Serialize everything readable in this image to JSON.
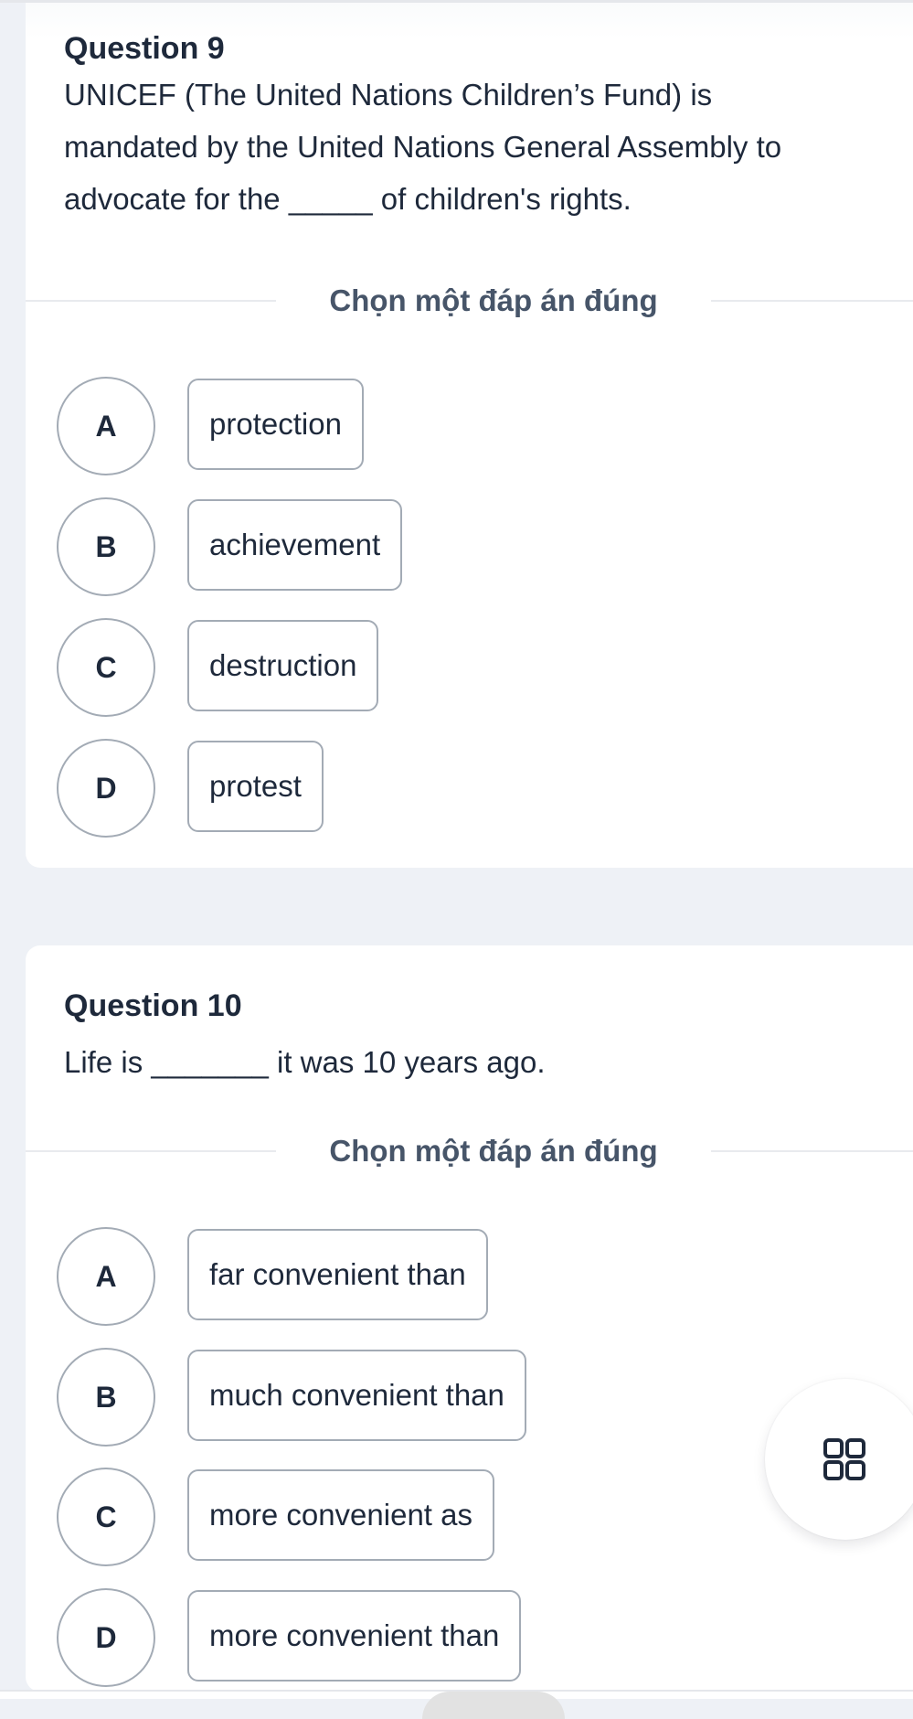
{
  "colors": {
    "page_background": "#eef1f6",
    "card_background": "#ffffff",
    "text_primary": "#1e293b",
    "text_secondary": "#475569",
    "border": "#a3abb5"
  },
  "questions": [
    {
      "title": "Question 9",
      "text_lines": [
        "UNICEF (The United Nations Children’s Fund) is",
        "mandated by the United Nations General Assembly to",
        "advocate for the _____ of children's rights."
      ],
      "instruction": "Chọn một đáp án đúng",
      "options": [
        {
          "letter": "A",
          "text": "protection"
        },
        {
          "letter": "B",
          "text": "achievement"
        },
        {
          "letter": "C",
          "text": "destruction"
        },
        {
          "letter": "D",
          "text": "protest"
        }
      ]
    },
    {
      "title": "Question 10",
      "text_lines": [
        "Life is _______ it was 10 years ago."
      ],
      "instruction": "Chọn một đáp án đúng",
      "options": [
        {
          "letter": "A",
          "text": "far convenient than"
        },
        {
          "letter": "B",
          "text": "much convenient than"
        },
        {
          "letter": "C",
          "text": "more convenient as"
        },
        {
          "letter": "D",
          "text": "more convenient than"
        }
      ]
    }
  ],
  "fab": {
    "icon": "grid-icon"
  }
}
